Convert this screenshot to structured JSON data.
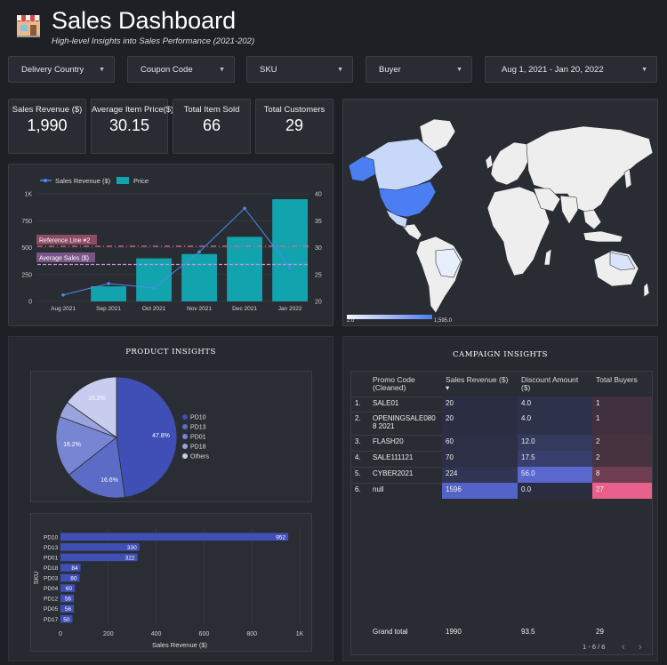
{
  "header": {
    "title": "Sales Dashboard",
    "subtitle": "High-level Insights into Sales Performance (2021-202)",
    "logo_icon": "storefront-icon"
  },
  "filters": [
    {
      "label": "Delivery Country"
    },
    {
      "label": "Coupon Code"
    },
    {
      "label": "SKU"
    },
    {
      "label": "Buyer"
    },
    {
      "label": "Aug 1, 2021 - Jan 20, 2022"
    }
  ],
  "kpis": [
    {
      "label": "Sales Revenue ($)",
      "value": "1,990"
    },
    {
      "label": "Average Item Price($)",
      "value": "30.15"
    },
    {
      "label": "Total Item Sold",
      "value": "66"
    },
    {
      "label": "Total Customers",
      "value": "29"
    }
  ],
  "combo_chart": {
    "legend": {
      "line": "Sales Revenue ($)",
      "bar": "Price"
    },
    "ref_line_label": "Reference Line #2",
    "avg_label": "Average Sales ($)",
    "y_left_ticks": [
      "1K",
      "750",
      "500",
      "250",
      "0"
    ],
    "y_right_ticks": [
      "40",
      "35",
      "30",
      "25",
      "20"
    ],
    "months": [
      "Aug 2021",
      "Sep 2021",
      "Oct 2021",
      "Nov 2021",
      "Dec 2021",
      "Jan 2022"
    ]
  },
  "map": {
    "scale_min": "2.0",
    "scale_max": "1,595.0",
    "colors": {
      "low": "#dde6fb",
      "high": "#4c7ef3",
      "land": "#eeeeee",
      "ocean": "#2a2c33"
    }
  },
  "product_insights": {
    "title": "PRODUCT INSIGHTS",
    "pie_legend": [
      "PD10",
      "PD13",
      "PD01",
      "PD18",
      "Others"
    ],
    "pie_labels": [
      "47.8%",
      "16.6%",
      "16.2%",
      "15.2%"
    ],
    "bar_y_label": "SKU",
    "bar_x_label": "Sales Revenue ($)",
    "bar_x_ticks": [
      "0",
      "200",
      "400",
      "600",
      "800",
      "1K"
    ],
    "bar_categories": [
      "PD10",
      "PD13",
      "PD01",
      "PD18",
      "PD03",
      "PD04",
      "PD12",
      "PD05",
      "PD17"
    ],
    "bar_value_labels": [
      "952",
      "330",
      "322",
      "84",
      "80",
      "60",
      "56",
      "56",
      "50"
    ]
  },
  "campaign_insights": {
    "title": "CAMPAIGN INSIGHTS",
    "headers": [
      "Promo Code (Cleaned)",
      "Sales Revenue ($) ▾",
      "Discount Amount ($)",
      "Total Buyers"
    ],
    "rows": [
      {
        "idx": "1.",
        "code": "SALE01",
        "rev": "20",
        "disc": "4.0",
        "buyers": "1"
      },
      {
        "idx": "2.",
        "code": "OPENINGSALE0808 2021",
        "rev": "20",
        "disc": "4.0",
        "buyers": "1"
      },
      {
        "idx": "3.",
        "code": "FLASH20",
        "rev": "60",
        "disc": "12.0",
        "buyers": "2"
      },
      {
        "idx": "4.",
        "code": "SALE111121",
        "rev": "70",
        "disc": "17.5",
        "buyers": "2"
      },
      {
        "idx": "5.",
        "code": "CYBER2021",
        "rev": "224",
        "disc": "56.0",
        "buyers": "8"
      },
      {
        "idx": "6.",
        "code": "null",
        "rev": "1596",
        "disc": "0.0",
        "buyers": "27"
      }
    ],
    "grand_total": {
      "label": "Grand total",
      "rev": "1990",
      "disc": "93.5",
      "buyers": "29"
    },
    "pagination": "1 - 6 / 6"
  },
  "chart_data": [
    {
      "type": "bar",
      "categories": [
        "Aug 2021",
        "Sep 2021",
        "Oct 2021",
        "Nov 2021",
        "Dec 2021",
        "Jan 2022"
      ],
      "series": [
        {
          "name": "Price",
          "values": [
            0,
            140,
            400,
            440,
            600,
            950
          ]
        },
        {
          "name": "Sales Revenue ($)",
          "values": [
            21.2,
            23.3,
            22.5,
            29.2,
            37.3,
            26.3
          ]
        }
      ],
      "ylim": [
        0,
        1000
      ],
      "y2lim": [
        20,
        40
      ],
      "reference_lines": {
        "Reference Line #2": 500,
        "Average Sales ($)": 30.15
      }
    },
    {
      "type": "pie",
      "categories": [
        "PD10",
        "PD13",
        "PD01",
        "PD18",
        "Others"
      ],
      "values": [
        47.8,
        16.6,
        16.2,
        4.2,
        15.2
      ]
    },
    {
      "type": "bar",
      "categories": [
        "PD10",
        "PD13",
        "PD01",
        "PD18",
        "PD03",
        "PD04",
        "PD12",
        "PD05",
        "PD17"
      ],
      "values": [
        952,
        330,
        322,
        84,
        80,
        60,
        56,
        56,
        50
      ],
      "xlabel": "Sales Revenue ($)",
      "ylabel": "SKU",
      "xlim": [
        0,
        1000
      ]
    }
  ]
}
